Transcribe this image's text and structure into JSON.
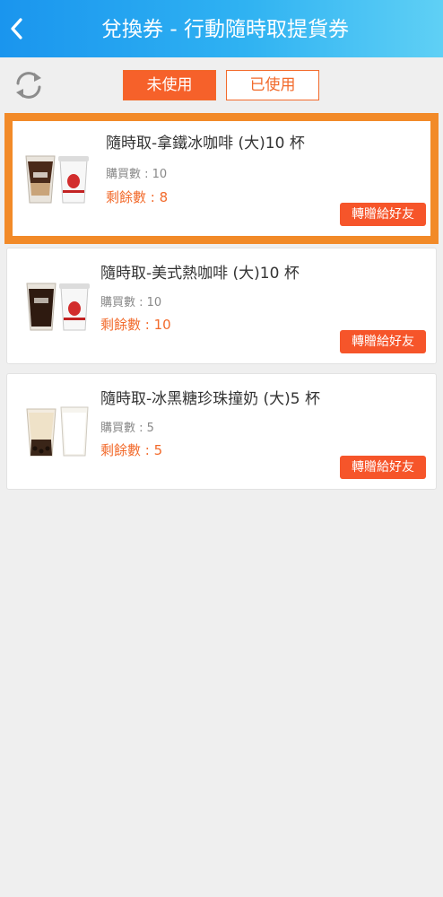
{
  "header": {
    "title": "兌換券 - 行動隨時取提貨券",
    "background_gradient": [
      "#1a95ee",
      "#5fd0f5"
    ]
  },
  "tabs": [
    {
      "label": "未使用",
      "active": true
    },
    {
      "label": "已使用",
      "active": false
    }
  ],
  "accent_color": "#f6612a",
  "vouchers": [
    {
      "name": "隨時取-拿鐵冰咖啡 (大)10 杯",
      "bought": "購買數 : 10",
      "remaining": "剩餘數 : 8",
      "gift_label": "轉贈給好友",
      "image": "iced-latte-and-hot-cup",
      "selected": true
    },
    {
      "name": "隨時取-美式熱咖啡 (大)10 杯",
      "bought": "購買數 : 10",
      "remaining": "剩餘數 : 10",
      "gift_label": "轉贈給好友",
      "image": "iced-americano-and-hot-cup",
      "selected": false
    },
    {
      "name": "隨時取-冰黑糖珍珠撞奶 (大)5 杯",
      "bought": "購買數 : 5",
      "remaining": "剩餘數 : 5",
      "gift_label": "轉贈給好友",
      "image": "bubble-milk-tea-and-milk",
      "selected": false
    }
  ],
  "icons": {
    "back": "chevron-left-icon",
    "refresh": "refresh-icon"
  }
}
